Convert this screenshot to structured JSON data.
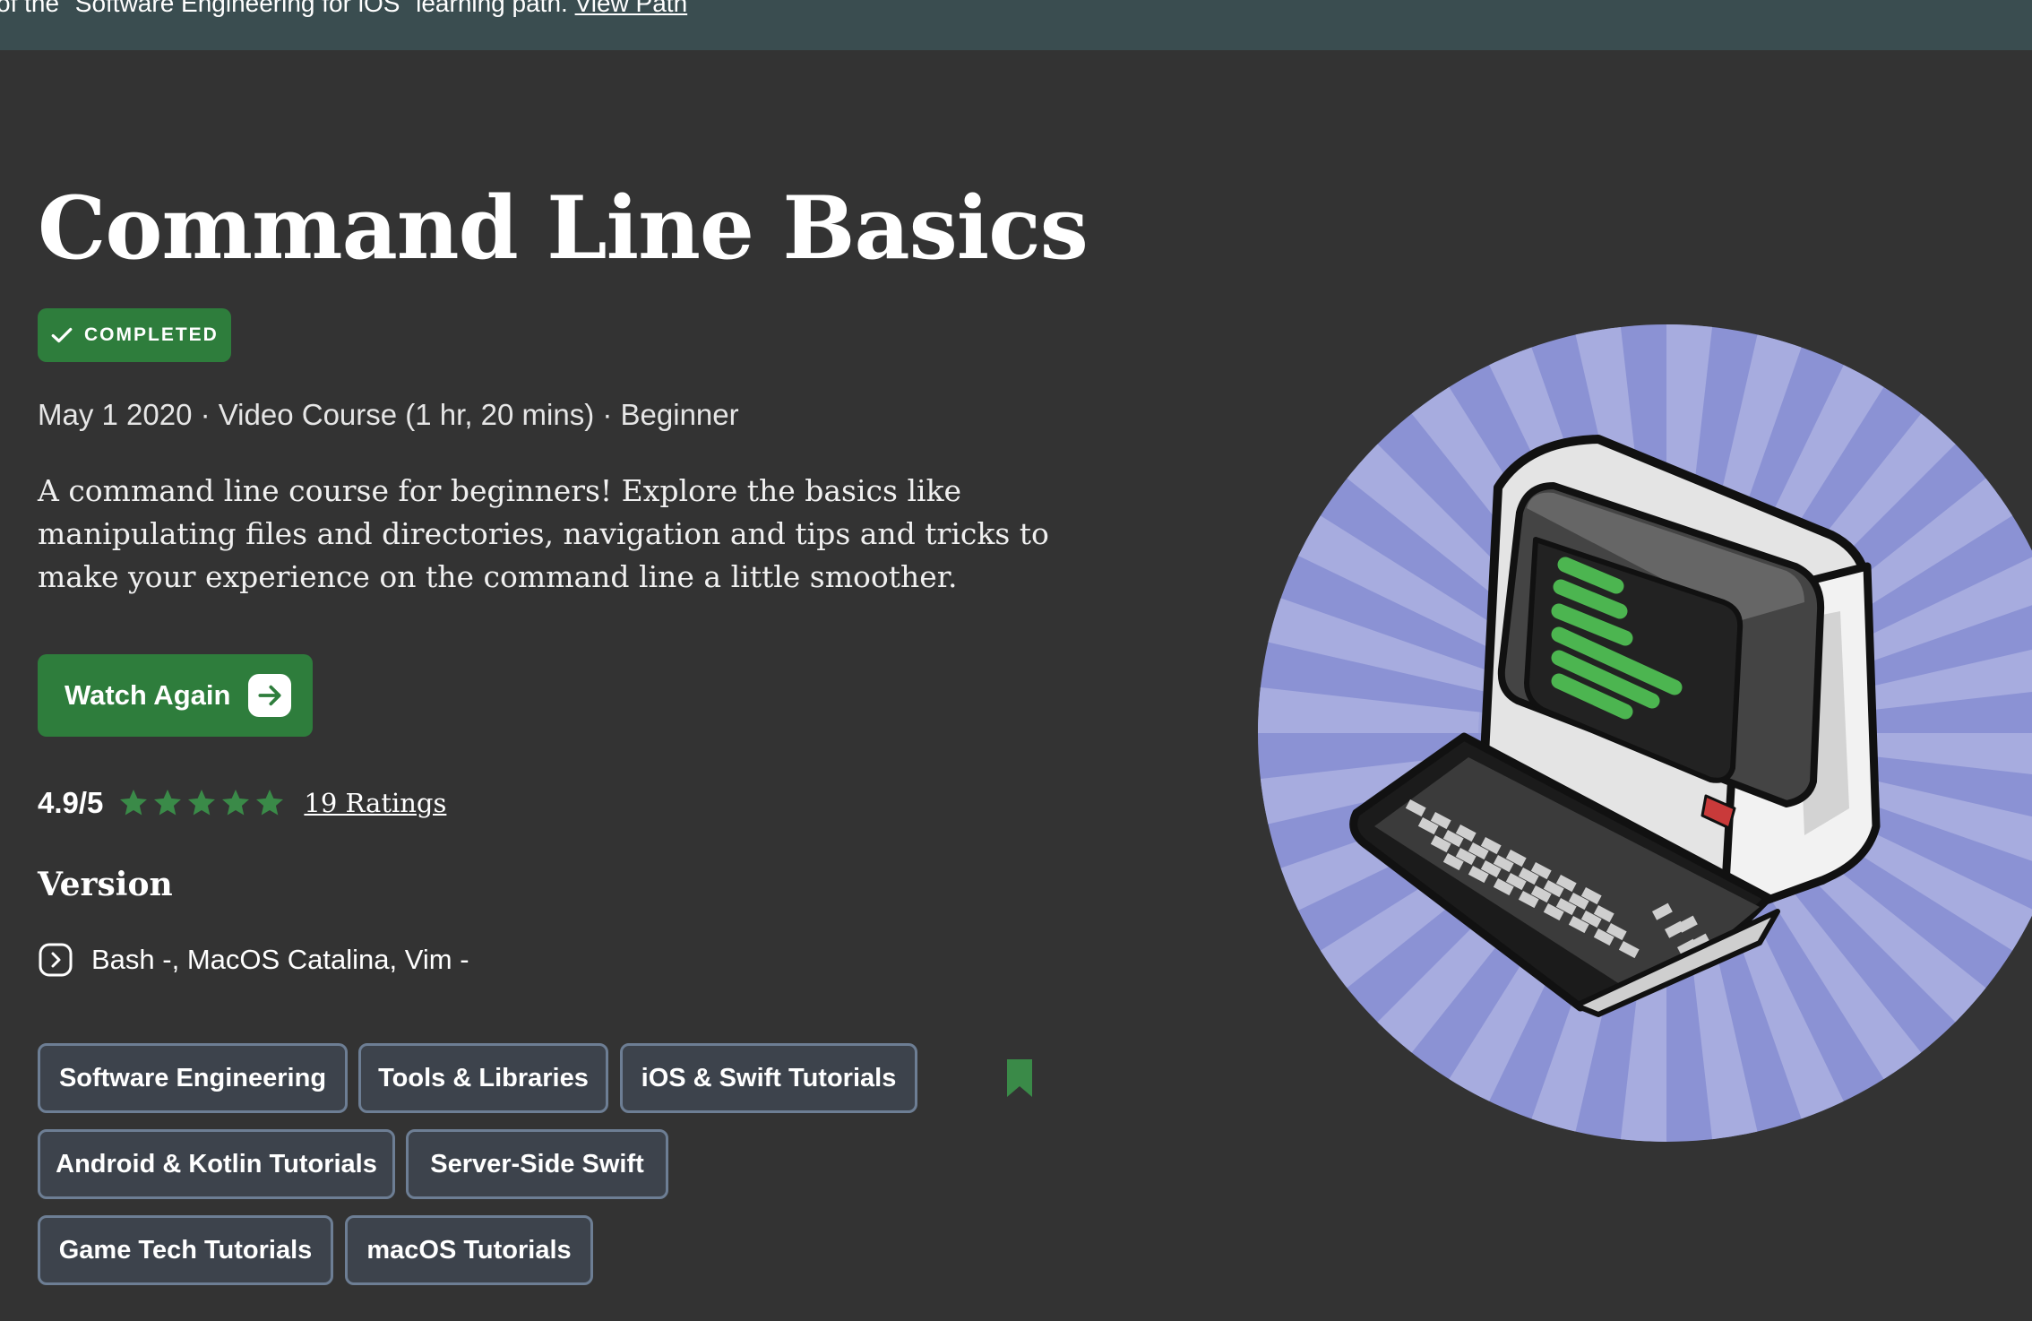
{
  "banner": {
    "text": "of the \"Software Engineering for iOS\" learning path.",
    "link": "View Path"
  },
  "course": {
    "title": "Command Line Basics",
    "status_badge": "COMPLETED",
    "meta": "May 1 2020 · Video Course (1 hr, 20 mins) · Beginner",
    "description": "A command line course for beginners! Explore the basics like manipulating files and directories, navigation and tips and tricks to make your experience on the command line a little smoother.",
    "watch_button": "Watch Again"
  },
  "rating": {
    "score": "4.9/5",
    "stars": 5,
    "count_link": "19 Ratings"
  },
  "version": {
    "heading": "Version",
    "value": "Bash -, MacOS Catalina, Vim -"
  },
  "tags": [
    "Software Engineering",
    "Tools & Libraries",
    "iOS & Swift Tutorials",
    "Android & Kotlin Tutorials",
    "Server-Side Swift",
    "Game Tech Tutorials",
    "macOS Tutorials"
  ],
  "icons": {
    "badge": "checkmark-icon",
    "watch": "arrow-right-icon",
    "rating": "star-icon",
    "version": "chevron-right-circle-icon",
    "bookmark": "bookmark-icon"
  },
  "colors": {
    "background": "#333333",
    "banner": "#3a4d50",
    "accent_green": "#2e7d3c",
    "tag_border": "#6d7e94",
    "illustration_bg": "#8b92d4"
  }
}
